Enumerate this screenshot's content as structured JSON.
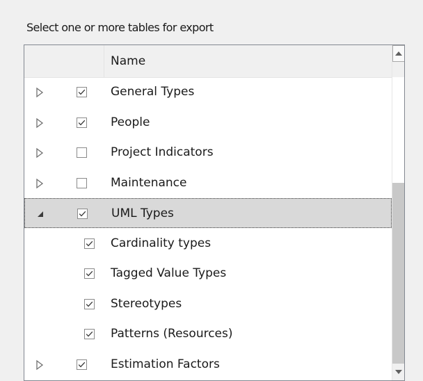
{
  "caption": "Select one or more tables for export",
  "header": {
    "name": "Name"
  },
  "rows": [
    {
      "label": "General Types",
      "expander": "collapsed",
      "checked": true,
      "level": 0
    },
    {
      "label": "People",
      "expander": "collapsed",
      "checked": true,
      "level": 0
    },
    {
      "label": "Project Indicators",
      "expander": "collapsed",
      "checked": false,
      "level": 0
    },
    {
      "label": "Maintenance",
      "expander": "collapsed",
      "checked": false,
      "level": 0
    },
    {
      "label": "UML Types",
      "expander": "expanded",
      "checked": true,
      "level": 0,
      "selected": true
    },
    {
      "label": "Cardinality types",
      "expander": "none",
      "checked": true,
      "level": 1
    },
    {
      "label": "Tagged Value Types",
      "expander": "none",
      "checked": true,
      "level": 1
    },
    {
      "label": "Stereotypes",
      "expander": "none",
      "checked": true,
      "level": 1
    },
    {
      "label": "Patterns (Resources)",
      "expander": "none",
      "checked": true,
      "level": 1
    },
    {
      "label": "Estimation Factors",
      "expander": "collapsed",
      "checked": true,
      "level": 0
    }
  ],
  "icons": {
    "collapsed": "triangle-right-outline-icon",
    "expanded": "triangle-filled-expanded-icon",
    "checked": "checkbox-checked-icon",
    "unchecked": "checkbox-unchecked-icon",
    "scroll_up": "scroll-up-arrow-icon",
    "scroll_down": "scroll-down-arrow-icon"
  },
  "colors": {
    "background": "#f0f0f0",
    "selection": "#d9d9d9",
    "border": "#828790"
  }
}
